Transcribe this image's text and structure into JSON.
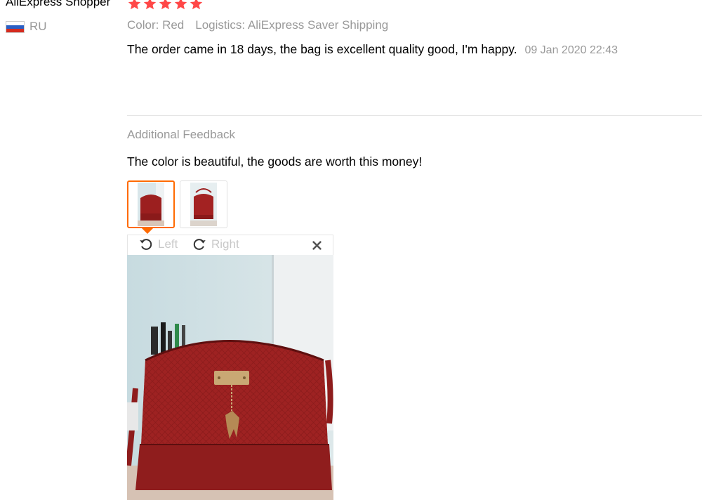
{
  "review": {
    "reviewer_name": "AliExpress Shopper",
    "rating": 5,
    "country_code": "RU",
    "color_label": "Color: Red",
    "logistics_label": "Logistics: AliExpress Saver Shipping",
    "text": "The order came in 18 days, the bag is excellent quality good, I'm happy.",
    "date": "09 Jan 2020 22:43"
  },
  "additional_feedback": {
    "title": "Additional Feedback",
    "text": "The color is beautiful, the goods are worth this money!"
  },
  "viewer": {
    "rotate_left_label": "Left",
    "rotate_right_label": "Right"
  },
  "colors": {
    "star": "#ff4747",
    "accent": "#ff6a00",
    "muted_text": "#999999",
    "bag_red": "#9c1f1f"
  },
  "icons": {
    "star": "star-icon",
    "flag": "flag-russia-icon",
    "rotate_left": "rotate-left-icon",
    "rotate_right": "rotate-right-icon",
    "close": "close-icon"
  }
}
